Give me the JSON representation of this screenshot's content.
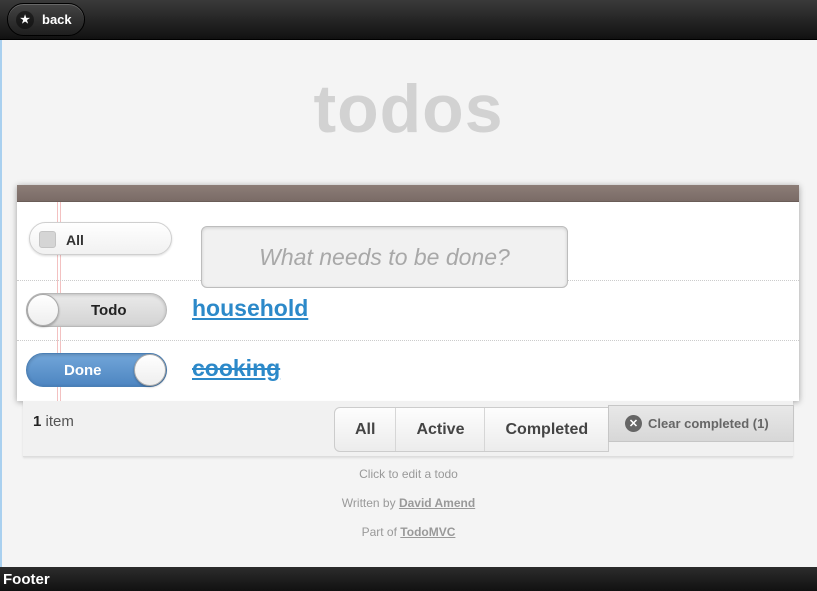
{
  "header": {
    "back_label": "back"
  },
  "app": {
    "title": "todos"
  },
  "toggle_all": {
    "label": "All"
  },
  "new_todo": {
    "placeholder": "What needs to be done?"
  },
  "todos": [
    {
      "title": "household",
      "status_label": "Todo",
      "completed": false
    },
    {
      "title": "cooking",
      "status_label": "Done",
      "completed": true
    }
  ],
  "footer": {
    "count": "1",
    "count_suffix": "item",
    "filters": [
      "All",
      "Active",
      "Completed"
    ],
    "clear_label": "Clear completed (1)"
  },
  "info": {
    "edit_hint": "Click to edit a todo",
    "written_by_prefix": "Written by",
    "author": "David Amend",
    "part_of_prefix": "Part of",
    "project": "TodoMVC"
  },
  "page_footer": {
    "label": "Footer"
  },
  "colors": {
    "accent": "#2c89c9",
    "header_bar": "#1e1e1e",
    "done_toggle": "#5b94cf",
    "title_gray": "#d2d2d2"
  },
  "icons": {
    "back": "star-icon",
    "clear": "close-circle-icon",
    "checkbox": "checkbox-icon"
  }
}
